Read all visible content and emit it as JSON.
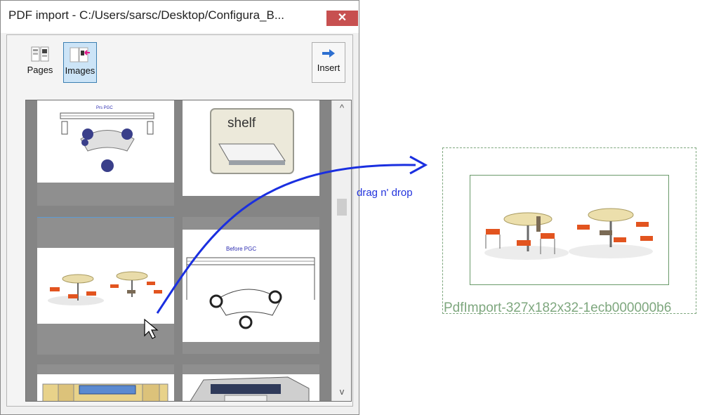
{
  "window": {
    "title": "PDF import - C:/Users/sarsc/Desktop/Configura_B...",
    "close_glyph": "✕"
  },
  "toolbar": {
    "pages_label": "Pages",
    "images_label": "Images",
    "insert_label": "Insert",
    "active_tab": "Images"
  },
  "gallery": {
    "tiles": [
      {
        "caption": "Prs PGC",
        "kind": "floorplan-top"
      },
      {
        "caption": "shelf",
        "kind": "shelf-icon"
      },
      {
        "caption": "",
        "kind": "tables-chairs"
      },
      {
        "caption": "Before PGC",
        "kind": "floorplan-before"
      },
      {
        "caption": "",
        "kind": "cabinet-elevation"
      },
      {
        "caption": "",
        "kind": "kitchen-3d"
      }
    ],
    "scroll_up": "^",
    "scroll_down": "v"
  },
  "annotation": {
    "drag_label": "drag n' drop",
    "arrow_color": "#1a2fe0"
  },
  "drop": {
    "caption": "PdfImport-327x182x32-1ecb000000b6"
  },
  "colors": {
    "accent": "#cce4f7",
    "close": "#c75050",
    "drop_border": "#7ea77e"
  }
}
